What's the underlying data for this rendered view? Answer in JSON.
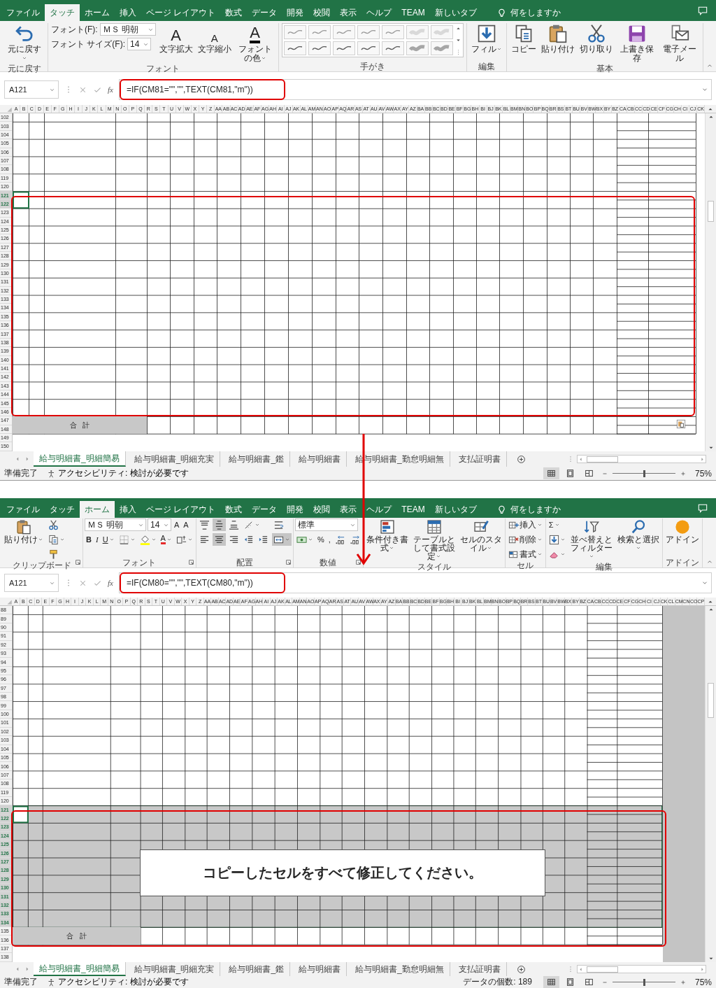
{
  "windows": [
    {
      "tabs": [
        {
          "label": "ファイル",
          "selected": false
        },
        {
          "label": "タッチ",
          "selected": true
        },
        {
          "label": "ホーム",
          "selected": false
        },
        {
          "label": "挿入",
          "selected": false
        },
        {
          "label": "ページ レイアウト",
          "selected": false
        },
        {
          "label": "数式",
          "selected": false
        },
        {
          "label": "データ",
          "selected": false
        },
        {
          "label": "開発",
          "selected": false
        },
        {
          "label": "校閲",
          "selected": false
        },
        {
          "label": "表示",
          "selected": false
        },
        {
          "label": "ヘルプ",
          "selected": false
        },
        {
          "label": "TEAM",
          "selected": false
        },
        {
          "label": "新しいタブ",
          "selected": false
        }
      ],
      "tell_me": "何をしますか",
      "groups": [
        {
          "label": "元に戻す",
          "launcher": false,
          "items": [
            {
              "kind": "undo",
              "label": "元に戻す",
              "dropdown": true
            }
          ]
        },
        {
          "label": "フォント",
          "launcher": false,
          "items": [
            {
              "kind": "column",
              "items": [
                {
                  "kind": "font-name",
                  "label": "フォント(F):",
                  "value": "ＭＳ 明朝",
                  "dropdown": true
                },
                {
                  "kind": "font-size",
                  "label": "フォント サイズ(F):",
                  "value": "14",
                  "dropdown": true
                }
              ]
            },
            {
              "kind": "grow",
              "text": "A",
              "label": "文字拡大"
            },
            {
              "kind": "shrink",
              "text": "A",
              "label": "文字縮小"
            },
            {
              "kind": "font-color",
              "text": "A",
              "label": "フォントの色",
              "dropdown": true
            }
          ]
        },
        {
          "label": "手がき",
          "launcher": false,
          "items": [
            {
              "kind": "pens",
              "pens": [
                {
                  "kind": "pen",
                  "color": "#9a9a9a"
                },
                {
                  "kind": "pen",
                  "color": "#9a9a9a"
                },
                {
                  "kind": "pen",
                  "color": "#9a9a9a"
                },
                {
                  "kind": "pen",
                  "color": "#9a9a9a"
                },
                {
                  "kind": "pen",
                  "color": "#9a9a9a"
                },
                {
                  "kind": "highlighter",
                  "color": "#d9d9d9"
                },
                {
                  "kind": "highlighter",
                  "color": "#d9d9d9"
                },
                {
                  "kind": "pen",
                  "color": "#5a5a5a"
                },
                {
                  "kind": "pen",
                  "color": "#5a5a5a"
                },
                {
                  "kind": "pen",
                  "color": "#5a5a5a"
                },
                {
                  "kind": "pen",
                  "color": "#5a5a5a"
                },
                {
                  "kind": "pen",
                  "color": "#5a5a5a"
                },
                {
                  "kind": "highlighter",
                  "color": "#a6a6a6"
                },
                {
                  "kind": "highlighter",
                  "color": "#a6a6a6"
                }
              ]
            }
          ]
        },
        {
          "label": "編集",
          "launcher": false,
          "items": [
            {
              "kind": "fill",
              "label": "フィル",
              "dropdown": true
            }
          ]
        },
        {
          "label": "基本",
          "launcher": false,
          "items": [
            {
              "kind": "copy",
              "label": "コピー"
            },
            {
              "kind": "paste",
              "label": "貼り付け"
            },
            {
              "kind": "cut",
              "label": "切り取り"
            },
            {
              "kind": "save",
              "label": "上書き保存"
            },
            {
              "kind": "email",
              "label": "電子メール"
            }
          ]
        }
      ],
      "name_box": "A121",
      "function_label": "fx",
      "formula": "=IF(CM81=\"\",\"\",TEXT(CM81,\"m\"))",
      "columns": [
        "A",
        "B",
        "C",
        "D",
        "E",
        "F",
        "G",
        "H",
        "I",
        "J",
        "K",
        "L",
        "M",
        "N",
        "O",
        "P",
        "Q",
        "R",
        "S",
        "T",
        "U",
        "V",
        "W",
        "X",
        "Y",
        "Z",
        "AA",
        "AB",
        "AC",
        "AD",
        "AE",
        "AF",
        "AG",
        "AH",
        "AI",
        "AJ",
        "AK",
        "AL",
        "AM",
        "AN",
        "AO",
        "AP",
        "AQ",
        "AR",
        "AS",
        "AT",
        "AU",
        "AV",
        "AW",
        "AX",
        "AY",
        "AZ",
        "BA",
        "BB",
        "BC",
        "BD",
        "BE",
        "BF",
        "BG",
        "BH",
        "BI",
        "BJ",
        "BK",
        "BL",
        "BM",
        "BN",
        "BO",
        "BP",
        "BQ",
        "BR",
        "BS",
        "BT",
        "BU",
        "BV",
        "BW",
        "BX",
        "BY",
        "BZ",
        "CA",
        "CB",
        "CC",
        "CD",
        "CE",
        "CF",
        "CG",
        "CH",
        "CI",
        "CJ",
        "CK"
      ],
      "rows": [
        {
          "label": "102",
          "kind": "body",
          "selected": false
        },
        {
          "label": "103",
          "kind": "body",
          "selected": false
        },
        {
          "label": "104",
          "kind": "body",
          "selected": false
        },
        {
          "label": "105",
          "kind": "body",
          "selected": false
        },
        {
          "label": "106",
          "kind": "body",
          "selected": false
        },
        {
          "label": "107",
          "kind": "body",
          "selected": false
        },
        {
          "label": "108",
          "kind": "body",
          "selected": false
        },
        {
          "label": "119",
          "kind": "body",
          "selected": false
        },
        {
          "label": "120",
          "kind": "body",
          "selected": false
        },
        {
          "label": "121",
          "kind": "body",
          "selected": true
        },
        {
          "label": "122",
          "kind": "body",
          "selected": true
        },
        {
          "label": "123",
          "kind": "body",
          "selected": false
        },
        {
          "label": "124",
          "kind": "body",
          "selected": false
        },
        {
          "label": "125",
          "kind": "body",
          "selected": false
        },
        {
          "label": "126",
          "kind": "body",
          "selected": false
        },
        {
          "label": "127",
          "kind": "body",
          "selected": false
        },
        {
          "label": "128",
          "kind": "body",
          "selected": false
        },
        {
          "label": "129",
          "kind": "body",
          "selected": false
        },
        {
          "label": "130",
          "kind": "body",
          "selected": false
        },
        {
          "label": "131",
          "kind": "body",
          "selected": false
        },
        {
          "label": "132",
          "kind": "body",
          "selected": false
        },
        {
          "label": "133",
          "kind": "body",
          "selected": false
        },
        {
          "label": "134",
          "kind": "body",
          "selected": false
        },
        {
          "label": "135",
          "kind": "body",
          "selected": false
        },
        {
          "label": "136",
          "kind": "body",
          "selected": false
        },
        {
          "label": "137",
          "kind": "body",
          "selected": false
        },
        {
          "label": "138",
          "kind": "body",
          "selected": false
        },
        {
          "label": "139",
          "kind": "body",
          "selected": false
        },
        {
          "label": "140",
          "kind": "body",
          "selected": false
        },
        {
          "label": "141",
          "kind": "body",
          "selected": false
        },
        {
          "label": "142",
          "kind": "body",
          "selected": false
        },
        {
          "label": "143",
          "kind": "body",
          "selected": false
        },
        {
          "label": "144",
          "kind": "body",
          "selected": false
        },
        {
          "label": "145",
          "kind": "body",
          "selected": false
        },
        {
          "label": "146",
          "kind": "body",
          "selected": false
        },
        {
          "label": "147",
          "kind": "total",
          "selected": false
        },
        {
          "label": "148",
          "kind": "total",
          "selected": false
        },
        {
          "label": "149",
          "kind": "blank",
          "selected": false
        },
        {
          "label": "150",
          "kind": "blank",
          "selected": false
        }
      ],
      "total_label": "合 計",
      "selection_shade": false,
      "page_break_view": false,
      "sheet_tabs": [
        {
          "label": "給与明細書_明細簡易",
          "selected": true
        },
        {
          "label": "給与明細書_明細充実",
          "selected": false
        },
        {
          "label": "給与明細書_鑑",
          "selected": false
        },
        {
          "label": "給与明細書",
          "selected": false
        },
        {
          "label": "給与明細書_勤怠明細無",
          "selected": false
        },
        {
          "label": "支払証明書",
          "selected": false
        }
      ],
      "status": "準備完了",
      "accessibility": "アクセシビリティ: 検討が必要です",
      "views": [
        {
          "kind": "normal",
          "selected": true
        },
        {
          "kind": "layout",
          "selected": false
        },
        {
          "kind": "break",
          "selected": false
        }
      ],
      "zoom": {
        "level": 0.5,
        "label": "75%"
      }
    },
    {
      "tabs": [
        {
          "label": "ファイル",
          "selected": false
        },
        {
          "label": "タッチ",
          "selected": false
        },
        {
          "label": "ホーム",
          "selected": true
        },
        {
          "label": "挿入",
          "selected": false
        },
        {
          "label": "ページ レイアウト",
          "selected": false
        },
        {
          "label": "数式",
          "selected": false
        },
        {
          "label": "データ",
          "selected": false
        },
        {
          "label": "開発",
          "selected": false
        },
        {
          "label": "校閲",
          "selected": false
        },
        {
          "label": "表示",
          "selected": false
        },
        {
          "label": "ヘルプ",
          "selected": false
        },
        {
          "label": "TEAM",
          "selected": false
        },
        {
          "label": "新しいタブ",
          "selected": false
        }
      ],
      "tell_me": "何をしますか",
      "groups": [
        {
          "label": "クリップボード",
          "launcher": true,
          "items": [
            {
              "kind": "paste",
              "label": "貼り付け",
              "dropdown": true
            },
            {
              "kind": "column",
              "items": [
                {
                  "kind": "cut"
                },
                {
                  "kind": "copy",
                  "dropdown": true
                },
                {
                  "kind": "brush"
                }
              ]
            }
          ]
        },
        {
          "label": "フォント",
          "launcher": true,
          "items": [
            {
              "kind": "column",
              "items": [
                {
                  "kind": "row",
                  "items": [
                    {
                      "kind": "font-name",
                      "value": "ＭＳ 明朝",
                      "dropdown": true
                    },
                    {
                      "kind": "font-size",
                      "value": "14",
                      "dropdown": true
                    },
                    {
                      "kind": "grow",
                      "text": "A"
                    },
                    {
                      "kind": "shrink",
                      "text": "A"
                    }
                  ]
                },
                {
                  "kind": "row",
                  "items": [
                    {
                      "kind": "bold",
                      "text": "B"
                    },
                    {
                      "kind": "italic",
                      "text": "I"
                    },
                    {
                      "kind": "underline",
                      "text": "U",
                      "dropdown": true
                    },
                    {
                      "kind": "border",
                      "dropdown": true
                    },
                    {
                      "kind": "bucket",
                      "dropdown": true
                    },
                    {
                      "kind": "font-color",
                      "text": "A",
                      "dropdown": true
                    },
                    {
                      "kind": "furigana",
                      "dropdown": true
                    }
                  ]
                }
              ]
            }
          ]
        },
        {
          "label": "配置",
          "launcher": true,
          "items": [
            {
              "kind": "column",
              "items": [
                {
                  "kind": "row",
                  "items": [
                    {
                      "kind": "align-top",
                      "on": false
                    },
                    {
                      "kind": "align-middle",
                      "on": true
                    },
                    {
                      "kind": "align-bottom",
                      "on": false
                    },
                    {
                      "kind": "orient",
                      "dropdown": true,
                      "on": false
                    }
                  ]
                },
                {
                  "kind": "row",
                  "items": [
                    {
                      "kind": "align-left",
                      "on": false
                    },
                    {
                      "kind": "align-center",
                      "on": true
                    },
                    {
                      "kind": "align-right",
                      "on": false
                    },
                    {
                      "kind": "outdent",
                      "on": false
                    },
                    {
                      "kind": "indent",
                      "on": false
                    }
                  ]
                }
              ]
            },
            {
              "kind": "column",
              "items": [
                {
                  "kind": "wrap",
                  "on": false
                },
                {
                  "kind": "merge",
                  "dropdown": true,
                  "on": true
                }
              ]
            }
          ]
        },
        {
          "label": "数値",
          "launcher": true,
          "items": [
            {
              "kind": "column",
              "items": [
                {
                  "kind": "number-format",
                  "value": "標準",
                  "dropdown": true
                },
                {
                  "kind": "row",
                  "items": [
                    {
                      "kind": "currency",
                      "dropdown": true
                    },
                    {
                      "kind": "percent",
                      "text": "%"
                    },
                    {
                      "kind": "comma",
                      "text": ","
                    },
                    {
                      "kind": "dec-inc"
                    },
                    {
                      "kind": "dec-dec"
                    }
                  ]
                }
              ]
            }
          ]
        },
        {
          "label": "スタイル",
          "launcher": false,
          "items": [
            {
              "kind": "cond",
              "label": "条件付き書式",
              "dropdown": true
            },
            {
              "kind": "table",
              "label": "テーブルとして書式設定",
              "dropdown": true
            },
            {
              "kind": "cellstyle",
              "label": "セルのスタイル",
              "dropdown": true
            }
          ]
        },
        {
          "label": "セル",
          "launcher": false,
          "items": [
            {
              "kind": "column",
              "items": [
                {
                  "kind": "insert",
                  "label": "挿入",
                  "dropdown": true
                },
                {
                  "kind": "delete",
                  "label": "削除",
                  "dropdown": true
                },
                {
                  "kind": "format",
                  "label": "書式",
                  "dropdown": true
                }
              ]
            }
          ]
        },
        {
          "label": "編集",
          "launcher": false,
          "items": [
            {
              "kind": "column",
              "items": [
                {
                  "kind": "sum",
                  "text": "Σ",
                  "dropdown": true
                },
                {
                  "kind": "fill",
                  "dropdown": true
                },
                {
                  "kind": "eraser",
                  "dropdown": true
                }
              ]
            },
            {
              "kind": "sort",
              "label": "並べ替えとフィルター",
              "dropdown": true
            },
            {
              "kind": "find",
              "label": "検索と選択",
              "dropdown": true
            }
          ]
        },
        {
          "label": "アドイン",
          "launcher": false,
          "items": [
            {
              "kind": "addin",
              "label": "アドイン"
            }
          ]
        }
      ],
      "name_box": "A121",
      "function_label": "fx",
      "formula": "=IF(CM80=\"\",\"\",TEXT(CM80,\"m\"))",
      "columns": [
        "A",
        "B",
        "C",
        "D",
        "E",
        "F",
        "G",
        "H",
        "I",
        "J",
        "K",
        "L",
        "M",
        "N",
        "O",
        "P",
        "Q",
        "R",
        "S",
        "T",
        "U",
        "V",
        "W",
        "X",
        "Y",
        "Z",
        "AA",
        "AB",
        "AC",
        "AD",
        "AE",
        "AF",
        "AG",
        "AH",
        "AI",
        "AJ",
        "AK",
        "AL",
        "AM",
        "AN",
        "AO",
        "AP",
        "AQ",
        "AR",
        "AS",
        "AT",
        "AU",
        "AV",
        "AW",
        "AX",
        "AY",
        "AZ",
        "BA",
        "BB",
        "BC",
        "BD",
        "BE",
        "BF",
        "BG",
        "BH",
        "BI",
        "BJ",
        "BK",
        "BL",
        "BM",
        "BN",
        "BO",
        "BP",
        "BQ",
        "BR",
        "BS",
        "BT",
        "BU",
        "BV",
        "BW",
        "BX",
        "BY",
        "BZ",
        "CA",
        "CB",
        "CC",
        "CD",
        "CE",
        "CF",
        "CG",
        "CH",
        "CI",
        "CJ",
        "CK",
        "CL",
        "CM",
        "CN",
        "CO",
        "CP"
      ],
      "rows": [
        {
          "label": "88",
          "kind": "body",
          "selected": false
        },
        {
          "label": "89",
          "kind": "body",
          "selected": false
        },
        {
          "label": "90",
          "kind": "body",
          "selected": false
        },
        {
          "label": "91",
          "kind": "body",
          "selected": false
        },
        {
          "label": "92",
          "kind": "body",
          "selected": false
        },
        {
          "label": "93",
          "kind": "body",
          "selected": false
        },
        {
          "label": "94",
          "kind": "body",
          "selected": false
        },
        {
          "label": "95",
          "kind": "body",
          "selected": false
        },
        {
          "label": "96",
          "kind": "body",
          "selected": false
        },
        {
          "label": "97",
          "kind": "body",
          "selected": false
        },
        {
          "label": "98",
          "kind": "body",
          "selected": false
        },
        {
          "label": "99",
          "kind": "body",
          "selected": false
        },
        {
          "label": "100",
          "kind": "body",
          "selected": false
        },
        {
          "label": "101",
          "kind": "body",
          "selected": false
        },
        {
          "label": "102",
          "kind": "body",
          "selected": false
        },
        {
          "label": "103",
          "kind": "body",
          "selected": false
        },
        {
          "label": "104",
          "kind": "body",
          "selected": false
        },
        {
          "label": "105",
          "kind": "body",
          "selected": false
        },
        {
          "label": "106",
          "kind": "body",
          "selected": false
        },
        {
          "label": "107",
          "kind": "body",
          "selected": false
        },
        {
          "label": "108",
          "kind": "body",
          "selected": false
        },
        {
          "label": "119",
          "kind": "body",
          "selected": false
        },
        {
          "label": "120",
          "kind": "body",
          "selected": false
        },
        {
          "label": "121",
          "kind": "body",
          "selected": true
        },
        {
          "label": "122",
          "kind": "body",
          "selected": true
        },
        {
          "label": "123",
          "kind": "body",
          "selected": true
        },
        {
          "label": "124",
          "kind": "body",
          "selected": true
        },
        {
          "label": "125",
          "kind": "body",
          "selected": true
        },
        {
          "label": "126",
          "kind": "body",
          "selected": true
        },
        {
          "label": "127",
          "kind": "body",
          "selected": true
        },
        {
          "label": "128",
          "kind": "body",
          "selected": true
        },
        {
          "label": "129",
          "kind": "body",
          "selected": true
        },
        {
          "label": "130",
          "kind": "body",
          "selected": true
        },
        {
          "label": "131",
          "kind": "body",
          "selected": true
        },
        {
          "label": "132",
          "kind": "body",
          "selected": true
        },
        {
          "label": "133",
          "kind": "body",
          "selected": true
        },
        {
          "label": "134",
          "kind": "body",
          "selected": true
        },
        {
          "label": "135",
          "kind": "total",
          "selected": false
        },
        {
          "label": "136",
          "kind": "total",
          "selected": false
        },
        {
          "label": "137",
          "kind": "blank",
          "selected": false
        },
        {
          "label": "138",
          "kind": "blank",
          "selected": false
        }
      ],
      "total_label": "合 計",
      "selection_shade": true,
      "page_break_view": true,
      "sheet_tabs": [
        {
          "label": "給与明細書_明細簡易",
          "selected": true
        },
        {
          "label": "給与明細書_明細充実",
          "selected": false
        },
        {
          "label": "給与明細書_鑑",
          "selected": false
        },
        {
          "label": "給与明細書",
          "selected": false
        },
        {
          "label": "給与明細書_勤怠明細無",
          "selected": false
        },
        {
          "label": "支払証明書",
          "selected": false
        }
      ],
      "status": "準備完了",
      "accessibility": "アクセシビリティ: 検討が必要です",
      "count": "データの個数: 189",
      "views": [
        {
          "kind": "normal",
          "selected": true
        },
        {
          "kind": "layout",
          "selected": false
        },
        {
          "kind": "break",
          "selected": false
        }
      ],
      "zoom": {
        "level": 0.5,
        "label": "75%"
      }
    }
  ],
  "callout": "コピーしたセルをすべて修正してください。"
}
